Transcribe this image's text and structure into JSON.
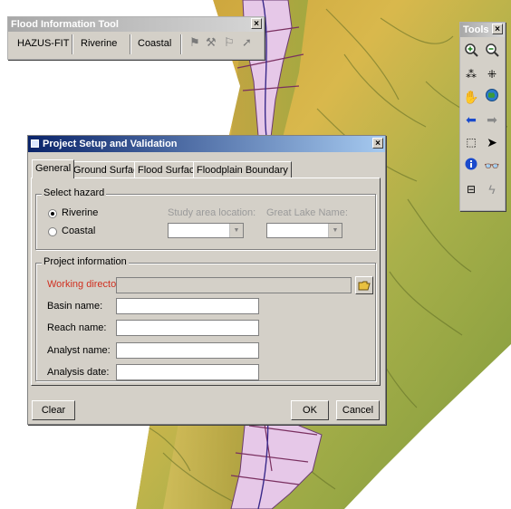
{
  "flood_toolbar": {
    "title": "Flood Information Tool",
    "close": "×",
    "menu": [
      "HAZUS-FIT",
      "Riverine",
      "Coastal"
    ]
  },
  "tools_palette": {
    "title": "Tools",
    "close": "×",
    "icons": [
      "zoom-in",
      "zoom-out",
      "fixed-zoom-in",
      "fixed-zoom-out",
      "pan",
      "full-extent",
      "back",
      "forward",
      "select-features",
      "select-elements",
      "identify",
      "find",
      "measure",
      "hyperlink"
    ]
  },
  "dialog": {
    "title": "Project Setup and Validation",
    "close": "×",
    "tabs": [
      "General",
      "Ground Surface",
      "Flood Surface",
      "Floodplain Boundary"
    ],
    "active_tab": "General",
    "select_hazard": {
      "legend": "Select hazard",
      "options": [
        "Riverine",
        "Coastal"
      ],
      "selected": "Riverine",
      "study_area_label": "Study area location:",
      "study_area_value": "",
      "great_lake_label": "Great Lake Name:",
      "great_lake_value": ""
    },
    "project_info": {
      "legend": "Project information",
      "working_directory_label": "Working directory:",
      "working_directory_value": "",
      "fields": [
        {
          "label": "Basin name:",
          "value": ""
        },
        {
          "label": "Reach name:",
          "value": ""
        },
        {
          "label": "Analyst name:",
          "value": ""
        },
        {
          "label": "Analysis date:",
          "value": ""
        }
      ]
    },
    "buttons": {
      "clear": "Clear",
      "ok": "OK",
      "cancel": "Cancel"
    }
  },
  "colors": {
    "titlebar_active": "#0a246a",
    "required_label": "#d03020",
    "floodplain": "#e6c8e8"
  }
}
